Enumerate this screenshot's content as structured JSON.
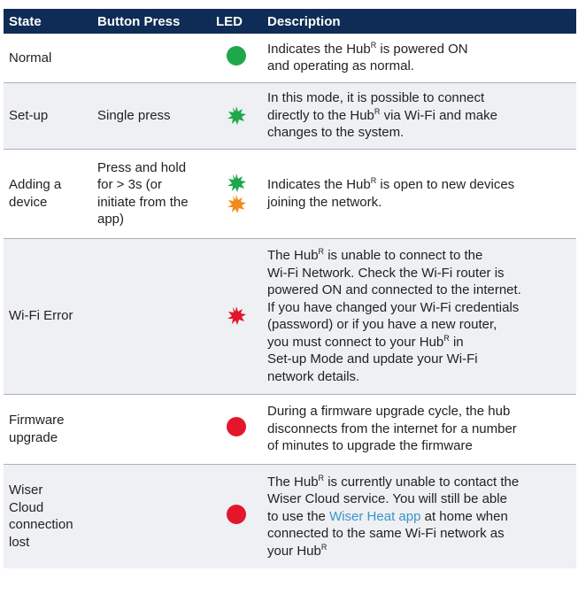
{
  "colors": {
    "header_bg": "#0e2c55",
    "row_alt": "#eef0f3",
    "green": "#1ea74b",
    "red": "#e3162b",
    "orange": "#f28a1c",
    "link": "#3a95c9"
  },
  "headers": {
    "state": "State",
    "button": "Button Press",
    "led": "LED",
    "description": "Description"
  },
  "rows": [
    {
      "state": "Normal",
      "button": "",
      "leds": [
        {
          "type": "dot",
          "color": "green"
        }
      ],
      "description": {
        "l1a": "Indicates the Hub",
        "l1sup": "R",
        "l1b": " is powered ON",
        "l2": "and operating as normal."
      }
    },
    {
      "state": "Set-up",
      "button": "Single press",
      "leds": [
        {
          "type": "flash",
          "color": "green"
        }
      ],
      "description": {
        "l1": "In this mode, it is possible to connect",
        "l2a": "directly to the Hub",
        "l2sup": "R",
        "l2b": " via Wi-Fi and make",
        "l3": "changes to the system."
      }
    },
    {
      "state": "Adding a device",
      "state_l1": "Adding a",
      "state_l2": "device",
      "button_l1": "Press and hold",
      "button_l2": "for > 3s (or",
      "button_l3": "initiate from the",
      "button_l4": "app)",
      "leds": [
        {
          "type": "flash",
          "color": "green"
        },
        {
          "type": "flash",
          "color": "orange"
        }
      ],
      "description": {
        "l1a": "Indicates the Hub",
        "l1sup": "R",
        "l1b": " is open to new devices",
        "l2": "joining the network."
      }
    },
    {
      "state": "Wi-Fi Error",
      "button": "",
      "leds": [
        {
          "type": "flash",
          "color": "red"
        }
      ],
      "description": {
        "l1a": "The Hub",
        "l1sup": "R",
        "l1b": " is unable to connect to the",
        "l2": "Wi-Fi Network. Check the Wi-Fi router is",
        "l3": "powered ON and connected to the internet.",
        "l4": "If you have changed your Wi-Fi credentials",
        "l5": "(password) or if you have a new router,",
        "l6a": "you must connect to your Hub",
        "l6sup": "R",
        "l6b": " in",
        "l7": "Set-up Mode and update your Wi-Fi",
        "l8": "network details."
      }
    },
    {
      "state_l1": "Firmware",
      "state_l2": "upgrade",
      "button": "",
      "leds": [
        {
          "type": "dot",
          "color": "red"
        }
      ],
      "description": {
        "l1": "During a firmware upgrade cycle, the hub",
        "l2": "disconnects from the internet for a number",
        "l3": "of minutes to upgrade the firmware"
      }
    },
    {
      "state_l1": "Wiser",
      "state_l2": "Cloud",
      "state_l3": "connection",
      "state_l4": "lost",
      "button": "",
      "leds": [
        {
          "type": "dot",
          "color": "red"
        }
      ],
      "description": {
        "l1a": "The Hub",
        "l1sup": "R",
        "l1b": " is currently unable to contact the",
        "l2": "Wiser Cloud service. You will still be able",
        "l3a": "to use the ",
        "l3link": "Wiser Heat app",
        "l3b": " at home when",
        "l4": "connected to the same Wi-Fi network as",
        "l5a": "your Hub",
        "l5sup": "R"
      }
    }
  ]
}
